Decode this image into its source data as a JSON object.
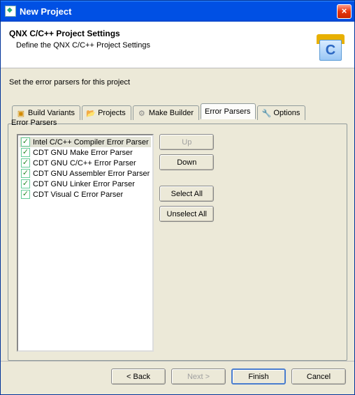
{
  "window": {
    "title": "New Project"
  },
  "header": {
    "title": "QNX C/C++ Project Settings",
    "subtitle": "Define the QNX C/C++ Project Settings",
    "icon_letter": "C"
  },
  "instruction": "Set the error parsers for this project",
  "tabs": [
    {
      "label": "Build Variants",
      "icon": "build",
      "active": false
    },
    {
      "label": "Projects",
      "icon": "folder",
      "active": false
    },
    {
      "label": "Make Builder",
      "icon": "make",
      "active": false
    },
    {
      "label": "Error Parsers",
      "icon": "",
      "active": true
    },
    {
      "label": "Options",
      "icon": "options",
      "active": false
    }
  ],
  "group": {
    "label": "Error Parsers"
  },
  "parsers": [
    {
      "checked": true,
      "label": "Intel C/C++ Compiler Error Parser",
      "selected": true
    },
    {
      "checked": true,
      "label": "CDT GNU Make Error Parser",
      "selected": false
    },
    {
      "checked": true,
      "label": "CDT GNU C/C++ Error Parser",
      "selected": false
    },
    {
      "checked": true,
      "label": "CDT GNU Assembler Error Parser",
      "selected": false
    },
    {
      "checked": true,
      "label": "CDT GNU Linker Error Parser",
      "selected": false
    },
    {
      "checked": true,
      "label": "CDT Visual C Error Parser",
      "selected": false
    }
  ],
  "side": {
    "up": "Up",
    "down": "Down",
    "select_all": "Select All",
    "unselect_all": "Unselect All"
  },
  "footer": {
    "back": "< Back",
    "next": "Next >",
    "finish": "Finish",
    "cancel": "Cancel"
  }
}
